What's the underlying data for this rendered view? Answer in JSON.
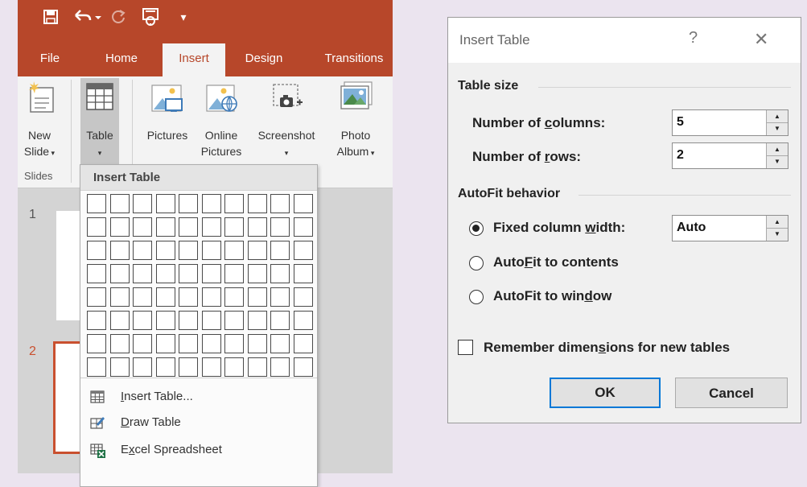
{
  "ribbon": {
    "tabs": [
      {
        "label": "File"
      },
      {
        "label": "Home"
      },
      {
        "label": "Insert",
        "active": true
      },
      {
        "label": "Design"
      },
      {
        "label": "Transitions"
      }
    ],
    "buttons": {
      "new_slide_line1": "New",
      "new_slide_line2": "Slide",
      "table": "Table",
      "pictures": "Pictures",
      "online_pictures_line1": "Online",
      "online_pictures_line2": "Pictures",
      "screenshot": "Screenshot",
      "photo_album_line1": "Photo",
      "photo_album_line2": "Album"
    },
    "groups": {
      "slides": "Slides"
    }
  },
  "slides": {
    "numbers": [
      "1",
      "2"
    ]
  },
  "table_dropdown": {
    "header": "Insert Table",
    "grid_columns": 10,
    "grid_rows": 8,
    "items": [
      {
        "prefix": "",
        "accel": "I",
        "rest": "nsert Table...",
        "icon": "table-grid-icon"
      },
      {
        "prefix": "",
        "accel": "D",
        "rest": "raw Table",
        "icon": "draw-table-icon"
      },
      {
        "prefix": "E",
        "accel": "x",
        "rest": "cel Spreadsheet",
        "icon": "excel-table-icon"
      }
    ]
  },
  "dialog": {
    "title": "Insert Table",
    "help": "?",
    "close": "✕",
    "table_size": {
      "heading": "Table size",
      "columns_label_pre": "Number of ",
      "columns_label_accel": "c",
      "columns_label_post": "olumns:",
      "columns_value": "5",
      "rows_label_pre": "Number of ",
      "rows_label_accel": "r",
      "rows_label_post": "ows:",
      "rows_value": "2"
    },
    "autofit": {
      "heading": "AutoFit behavior",
      "fixed_pre": "Fixed column ",
      "fixed_accel": "w",
      "fixed_post": "idth:",
      "fixed_value": "Auto",
      "contents_pre": "Auto",
      "contents_accel": "F",
      "contents_post": "it to contents",
      "window_pre": "AutoFit to win",
      "window_accel": "d",
      "window_post": "ow",
      "selected": "fixed"
    },
    "remember_pre": "Remember dimen",
    "remember_accel": "s",
    "remember_post": "ions for new tables",
    "remember_checked": false,
    "ok": "OK",
    "cancel": "Cancel"
  },
  "colors": {
    "accent": "#b7472a",
    "background": "#ebe4ef",
    "dialog_focus": "#0078d7"
  }
}
